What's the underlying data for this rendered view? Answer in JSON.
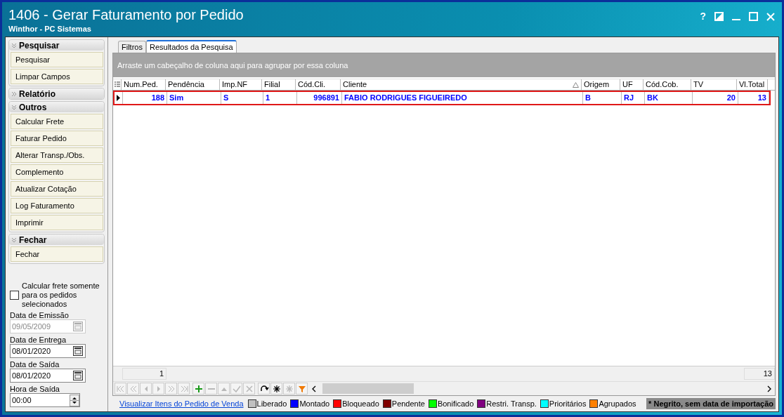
{
  "window": {
    "title": "1406 - Gerar Faturamento por Pedido",
    "subtitle": "Winthor - PC Sistemas",
    "help": "?"
  },
  "sidebar": {
    "groups": [
      {
        "title": "Pesquisar",
        "expanded": true,
        "items": [
          "Pesquisar",
          "Limpar Campos"
        ]
      },
      {
        "title": "Relatório",
        "expanded": false
      },
      {
        "title": "Outros",
        "expanded": true,
        "items": [
          "Calcular Frete",
          "Faturar Pedido",
          "Alterar Transp./Obs.",
          "Complemento",
          "Atualizar Cotação",
          "Log Faturamento",
          "Imprimir"
        ]
      },
      {
        "title": "Fechar",
        "expanded": true,
        "items": [
          "Fechar"
        ]
      }
    ],
    "option": {
      "label": "Calcular frete somente para os pedidos selecionados",
      "checked": false
    },
    "fields": [
      {
        "kind": "date",
        "label": "Data de Emissão",
        "value": "09/05/2009",
        "disabled": true
      },
      {
        "kind": "date",
        "label": "Data de Entrega",
        "value": "08/01/2020",
        "disabled": false
      },
      {
        "kind": "date",
        "label": "Data de Saída",
        "value": "08/01/2020",
        "disabled": false
      },
      {
        "kind": "time",
        "label": "Hora de Saída",
        "value": "00:00",
        "disabled": false
      }
    ]
  },
  "tabs": [
    {
      "label": "Filtros",
      "selected": false
    },
    {
      "label": "Resultados da Pesquisa",
      "selected": true
    }
  ],
  "grid": {
    "group_hint": "Arraste um cabeçalho de coluna aqui para agrupar por essa coluna",
    "columns": [
      {
        "label": "Num.Ped.",
        "sorted": false
      },
      {
        "label": "Pendência",
        "sorted": false
      },
      {
        "label": "Imp.NF",
        "sorted": false
      },
      {
        "label": "Filial",
        "sorted": false
      },
      {
        "label": "Cód.Cli.",
        "sorted": false
      },
      {
        "label": "Cliente",
        "sorted": true
      },
      {
        "label": "Origem",
        "sorted": false
      },
      {
        "label": "UF",
        "sorted": false
      },
      {
        "label": "Cód.Cob.",
        "sorted": false
      },
      {
        "label": "TV",
        "sorted": false
      },
      {
        "label": "Vl.Total",
        "sorted": false
      }
    ],
    "rows": [
      {
        "selected": true,
        "cells": [
          "188",
          "Sim",
          "S",
          "1",
          "996891",
          "FABIO RODRIGUES FIGUEIREDO",
          "B",
          "RJ",
          "BK",
          "20",
          "13"
        ]
      }
    ],
    "footer": {
      "count": "1",
      "total": "13"
    },
    "navigator": [
      {
        "kind": "first",
        "disabled": true
      },
      {
        "kind": "prev_page",
        "disabled": true
      },
      {
        "kind": "prev",
        "disabled": true
      },
      {
        "kind": "next",
        "disabled": true
      },
      {
        "kind": "next_page",
        "disabled": true
      },
      {
        "kind": "last",
        "disabled": true
      },
      {
        "kind": "insert",
        "disabled": false
      },
      {
        "kind": "delete",
        "disabled": true
      },
      {
        "kind": "edit",
        "disabled": true
      },
      {
        "kind": "post",
        "disabled": true
      },
      {
        "kind": "cancel",
        "disabled": true
      },
      {
        "kind": "refresh",
        "disabled": false
      },
      {
        "kind": "bookmark",
        "disabled": false
      },
      {
        "kind": "goto_bookmark",
        "disabled": true
      },
      {
        "kind": "filter",
        "disabled": false
      }
    ]
  },
  "legend": {
    "link": "Visualizar Itens do Pedido de Venda",
    "items": [
      {
        "label": "Liberado",
        "color": "#c0c0c0"
      },
      {
        "label": "Montado",
        "color": "#0000ff"
      },
      {
        "label": "Bloqueado",
        "color": "#ff0000"
      },
      {
        "label": "Pendente",
        "color": "#800000"
      },
      {
        "label": "Bonificado",
        "color": "#00ff00"
      },
      {
        "label": "Restri. Transp.",
        "color": "#800080"
      },
      {
        "label": "Prioritários",
        "color": "#00ffff"
      },
      {
        "label": "Agrupados",
        "color": "#ff8000"
      }
    ],
    "note": "* Negrito, sem data de importação"
  }
}
